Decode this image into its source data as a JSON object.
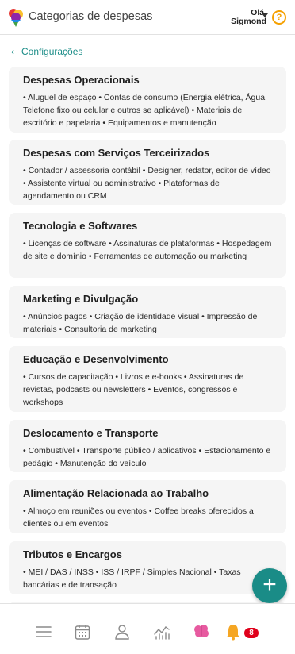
{
  "header": {
    "title": "Categorias de despesas",
    "greeting": "Olá,",
    "user_name": "Sigmond",
    "help_symbol": "?"
  },
  "breadcrumb": {
    "label": "Configurações",
    "back_icon": "chevron-left-icon"
  },
  "categories": [
    {
      "title": "Despesas Operacionais",
      "items": "• Aluguel de espaço • Contas de consumo (Energia elétrica, Água, Telefone fixo ou celular e outros se aplicável) • Materiais de escritório e papelaria • Equipamentos e manutenção"
    },
    {
      "title": "Despesas com Serviços Terceirizados",
      "items": "• Contador / assessoria contábil • Designer, redator, editor de vídeo • Assistente virtual ou administrativo • Plataformas de agendamento ou CRM"
    },
    {
      "title": "Tecnologia e Softwares",
      "items": "• Licenças de software • Assinaturas de plataformas • Hospedagem de site e domínio • Ferramentas de automação ou marketing"
    },
    {
      "title": "Marketing e Divulgação",
      "items": "• Anúncios pagos • Criação de identidade visual • Impressão de materiais • Consultoria de marketing"
    },
    {
      "title": "Educação e Desenvolvimento",
      "items": "• Cursos de capacitação • Livros e e-books • Assinaturas de revistas, podcasts ou newsletters • Eventos, congressos e workshops"
    },
    {
      "title": "Deslocamento e Transporte",
      "items": "• Combustível • Transporte público / aplicativos • Estacionamento e pedágio • Manutenção do veículo"
    },
    {
      "title": "Alimentação Relacionada ao Trabalho",
      "items": "• Almoço em reuniões ou eventos • Coffee breaks oferecidos a clientes ou em eventos"
    },
    {
      "title": "Tributos e Encargos",
      "items": "• MEI / DAS / INSS • ISS / IRPF / Simples Nacional • Taxas bancárias e de transação"
    }
  ],
  "fab": {
    "symbol": "+"
  },
  "bottom_nav": {
    "items": [
      "menu-icon",
      "calendar-icon",
      "user-icon",
      "chart-icon",
      "brain-icon",
      "bell-icon"
    ],
    "notification_count": "8"
  },
  "colors": {
    "accent": "#1a8c87",
    "help": "#f5a000",
    "badge": "#e0001b",
    "card_bg": "#f5f5f5"
  }
}
